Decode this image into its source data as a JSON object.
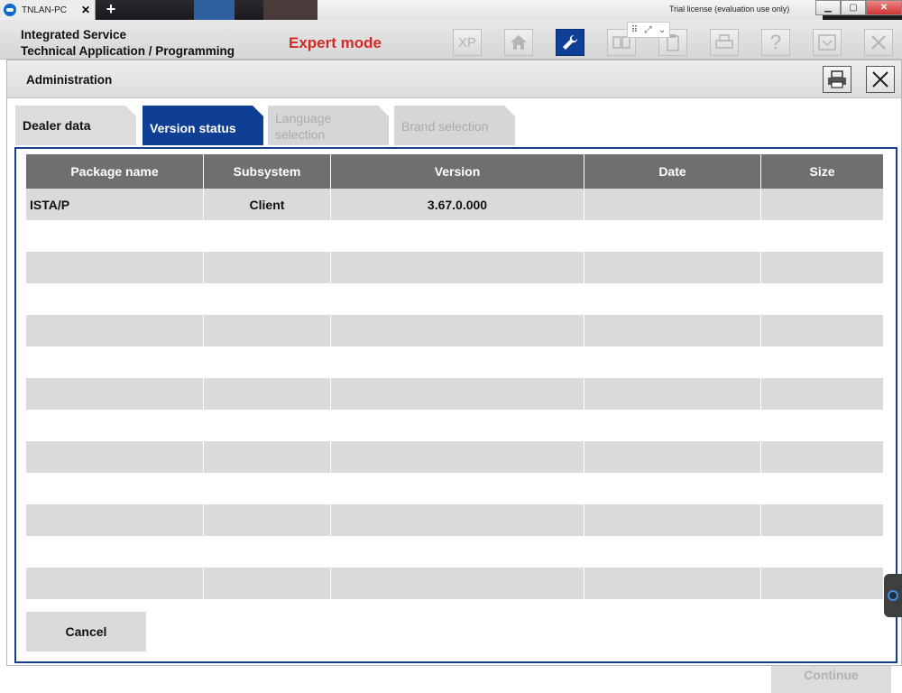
{
  "remote_session": {
    "tab_label": "TNLAN-PC",
    "tab_close": "✕",
    "add_symbol": "+",
    "trial_text": "Trial license (evaluation use only)"
  },
  "header": {
    "title_line1": "Integrated Service",
    "title_line2": "Technical Application / Programming",
    "mode": "Expert mode",
    "xp_label": "XP",
    "help_label": "?"
  },
  "dialog": {
    "title": "Administration"
  },
  "tabs": [
    {
      "label": "Dealer data",
      "state": "normal"
    },
    {
      "label": "Version status",
      "state": "active"
    },
    {
      "label_line1": "Language",
      "label_line2": "selection",
      "state": "disabled"
    },
    {
      "label": "Brand selection",
      "state": "disabled"
    }
  ],
  "table": {
    "columns": [
      "Package name",
      "Subsystem",
      "Version",
      "Date",
      "Size"
    ],
    "rows": [
      [
        "ISTA/P",
        "Client",
        "3.67.0.000",
        "",
        ""
      ]
    ]
  },
  "buttons": {
    "cancel": "Cancel",
    "continue": "Continue"
  },
  "colors": {
    "accent_blue": "#0f3f94",
    "expert_red": "#d22a2a",
    "header_gray": "#6f6f6f",
    "row_gray": "#dadada"
  }
}
